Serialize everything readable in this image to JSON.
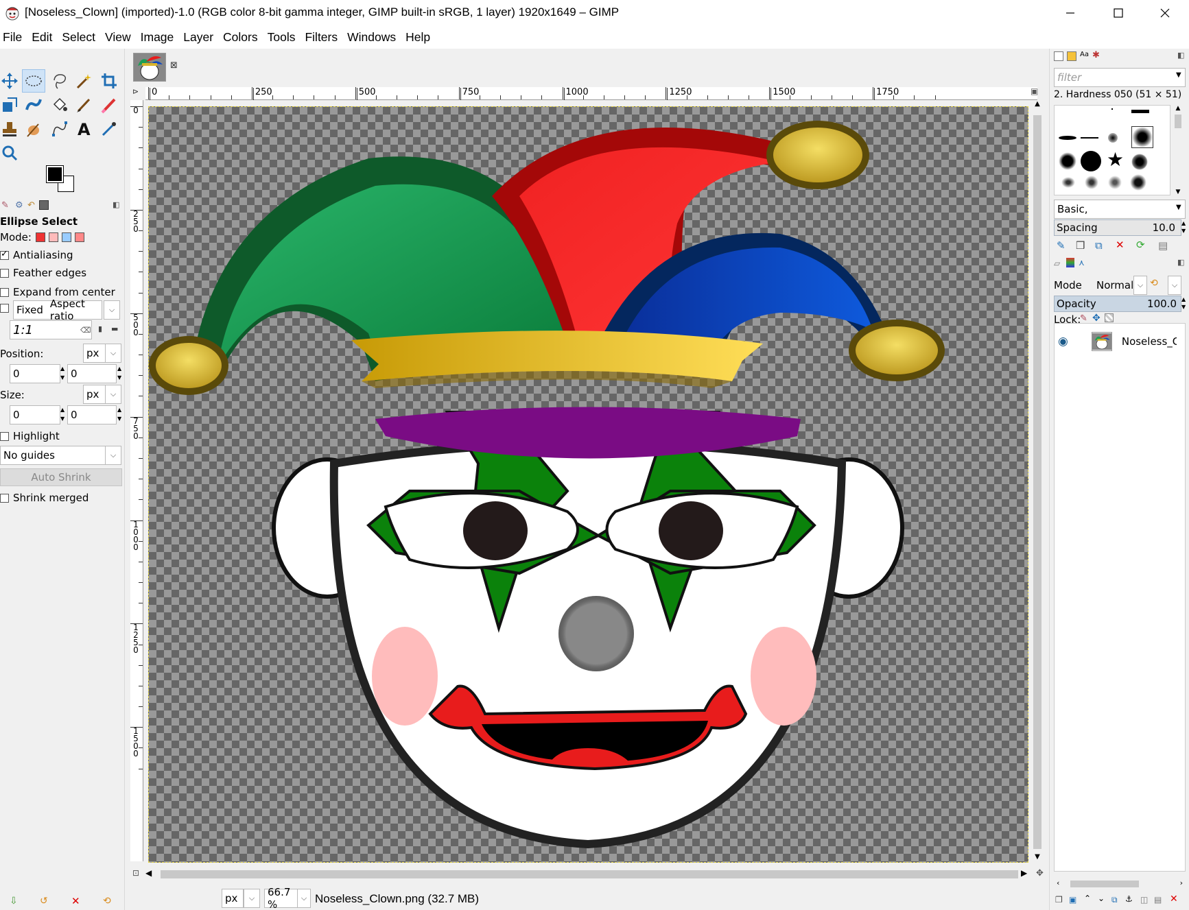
{
  "titlebar": {
    "title": "[Noseless_Clown] (imported)-1.0 (RGB color 8-bit gamma integer, GIMP built-in sRGB, 1 layer) 1920x1649 – GIMP",
    "minimize_icon": "minimize-icon",
    "maximize_icon": "maximize-icon",
    "close_icon": "close-icon"
  },
  "menubar": {
    "items": [
      "File",
      "Edit",
      "Select",
      "View",
      "Image",
      "Layer",
      "Colors",
      "Tools",
      "Filters",
      "Windows",
      "Help"
    ]
  },
  "toolbox": {
    "tools": [
      "move",
      "ellipse-select",
      "free-select",
      "fuzzy-select",
      "crop",
      "unified-transform",
      "warp-transform",
      "gegl-operation",
      "paintbrush",
      "eraser",
      "clone",
      "smudge",
      "paths",
      "text",
      "color-picker",
      "zoom"
    ],
    "active_tool": "ellipse-select",
    "fg_color": "#000000",
    "bg_color": "#ffffff"
  },
  "tool_options": {
    "title": "Ellipse Select",
    "mode_label": "Mode:",
    "antialiasing": {
      "label": "Antialiasing",
      "checked": true
    },
    "feather_edges": {
      "label": "Feather edges",
      "checked": false
    },
    "expand_from_center": {
      "label": "Expand from center",
      "checked": false
    },
    "fixed": {
      "label": "Fixed",
      "checked": false,
      "option": "Aspect ratio"
    },
    "ratio_value": "1:1",
    "position_label": "Position:",
    "position_unit": "px",
    "position_x": "0",
    "position_y": "0",
    "size_label": "Size:",
    "size_unit": "px",
    "size_w": "0",
    "size_h": "0",
    "highlight": {
      "label": "Highlight",
      "checked": false
    },
    "guides": "No guides",
    "auto_shrink": "Auto Shrink",
    "shrink_merged": {
      "label": "Shrink merged",
      "checked": false
    }
  },
  "image_tab": {
    "name": "Noseless_Clown thumbnail"
  },
  "rulers": {
    "top": [
      "0",
      "250",
      "500",
      "750",
      "1000",
      "1250",
      "1500",
      "1750"
    ],
    "left": [
      "0",
      "250",
      "500",
      "750",
      "1000",
      "1250",
      "1500"
    ]
  },
  "statusbar": {
    "unit": "px",
    "zoom": "66.7 %",
    "file_info": "Noseless_Clown.png (32.7 MB)"
  },
  "brushes": {
    "filter_placeholder": "filter",
    "selected_brush": "2. Hardness 050 (51 × 51)",
    "tag": "Basic,",
    "spacing_label": "Spacing",
    "spacing_value": "10.0"
  },
  "layers": {
    "mode_label": "Mode",
    "mode_value": "Normal",
    "opacity_label": "Opacity",
    "opacity_value": "100.0",
    "lock_label": "Lock:",
    "items": [
      {
        "name": "Noseless_Cl",
        "visible": true
      }
    ]
  },
  "colors": {
    "accent": "#cfe3f7",
    "hat_green": "#1e9e55",
    "hat_red": "#e81c1c",
    "hat_blue": "#0b47c2",
    "gold": "#d9b52c",
    "purple": "#7a0c84"
  }
}
